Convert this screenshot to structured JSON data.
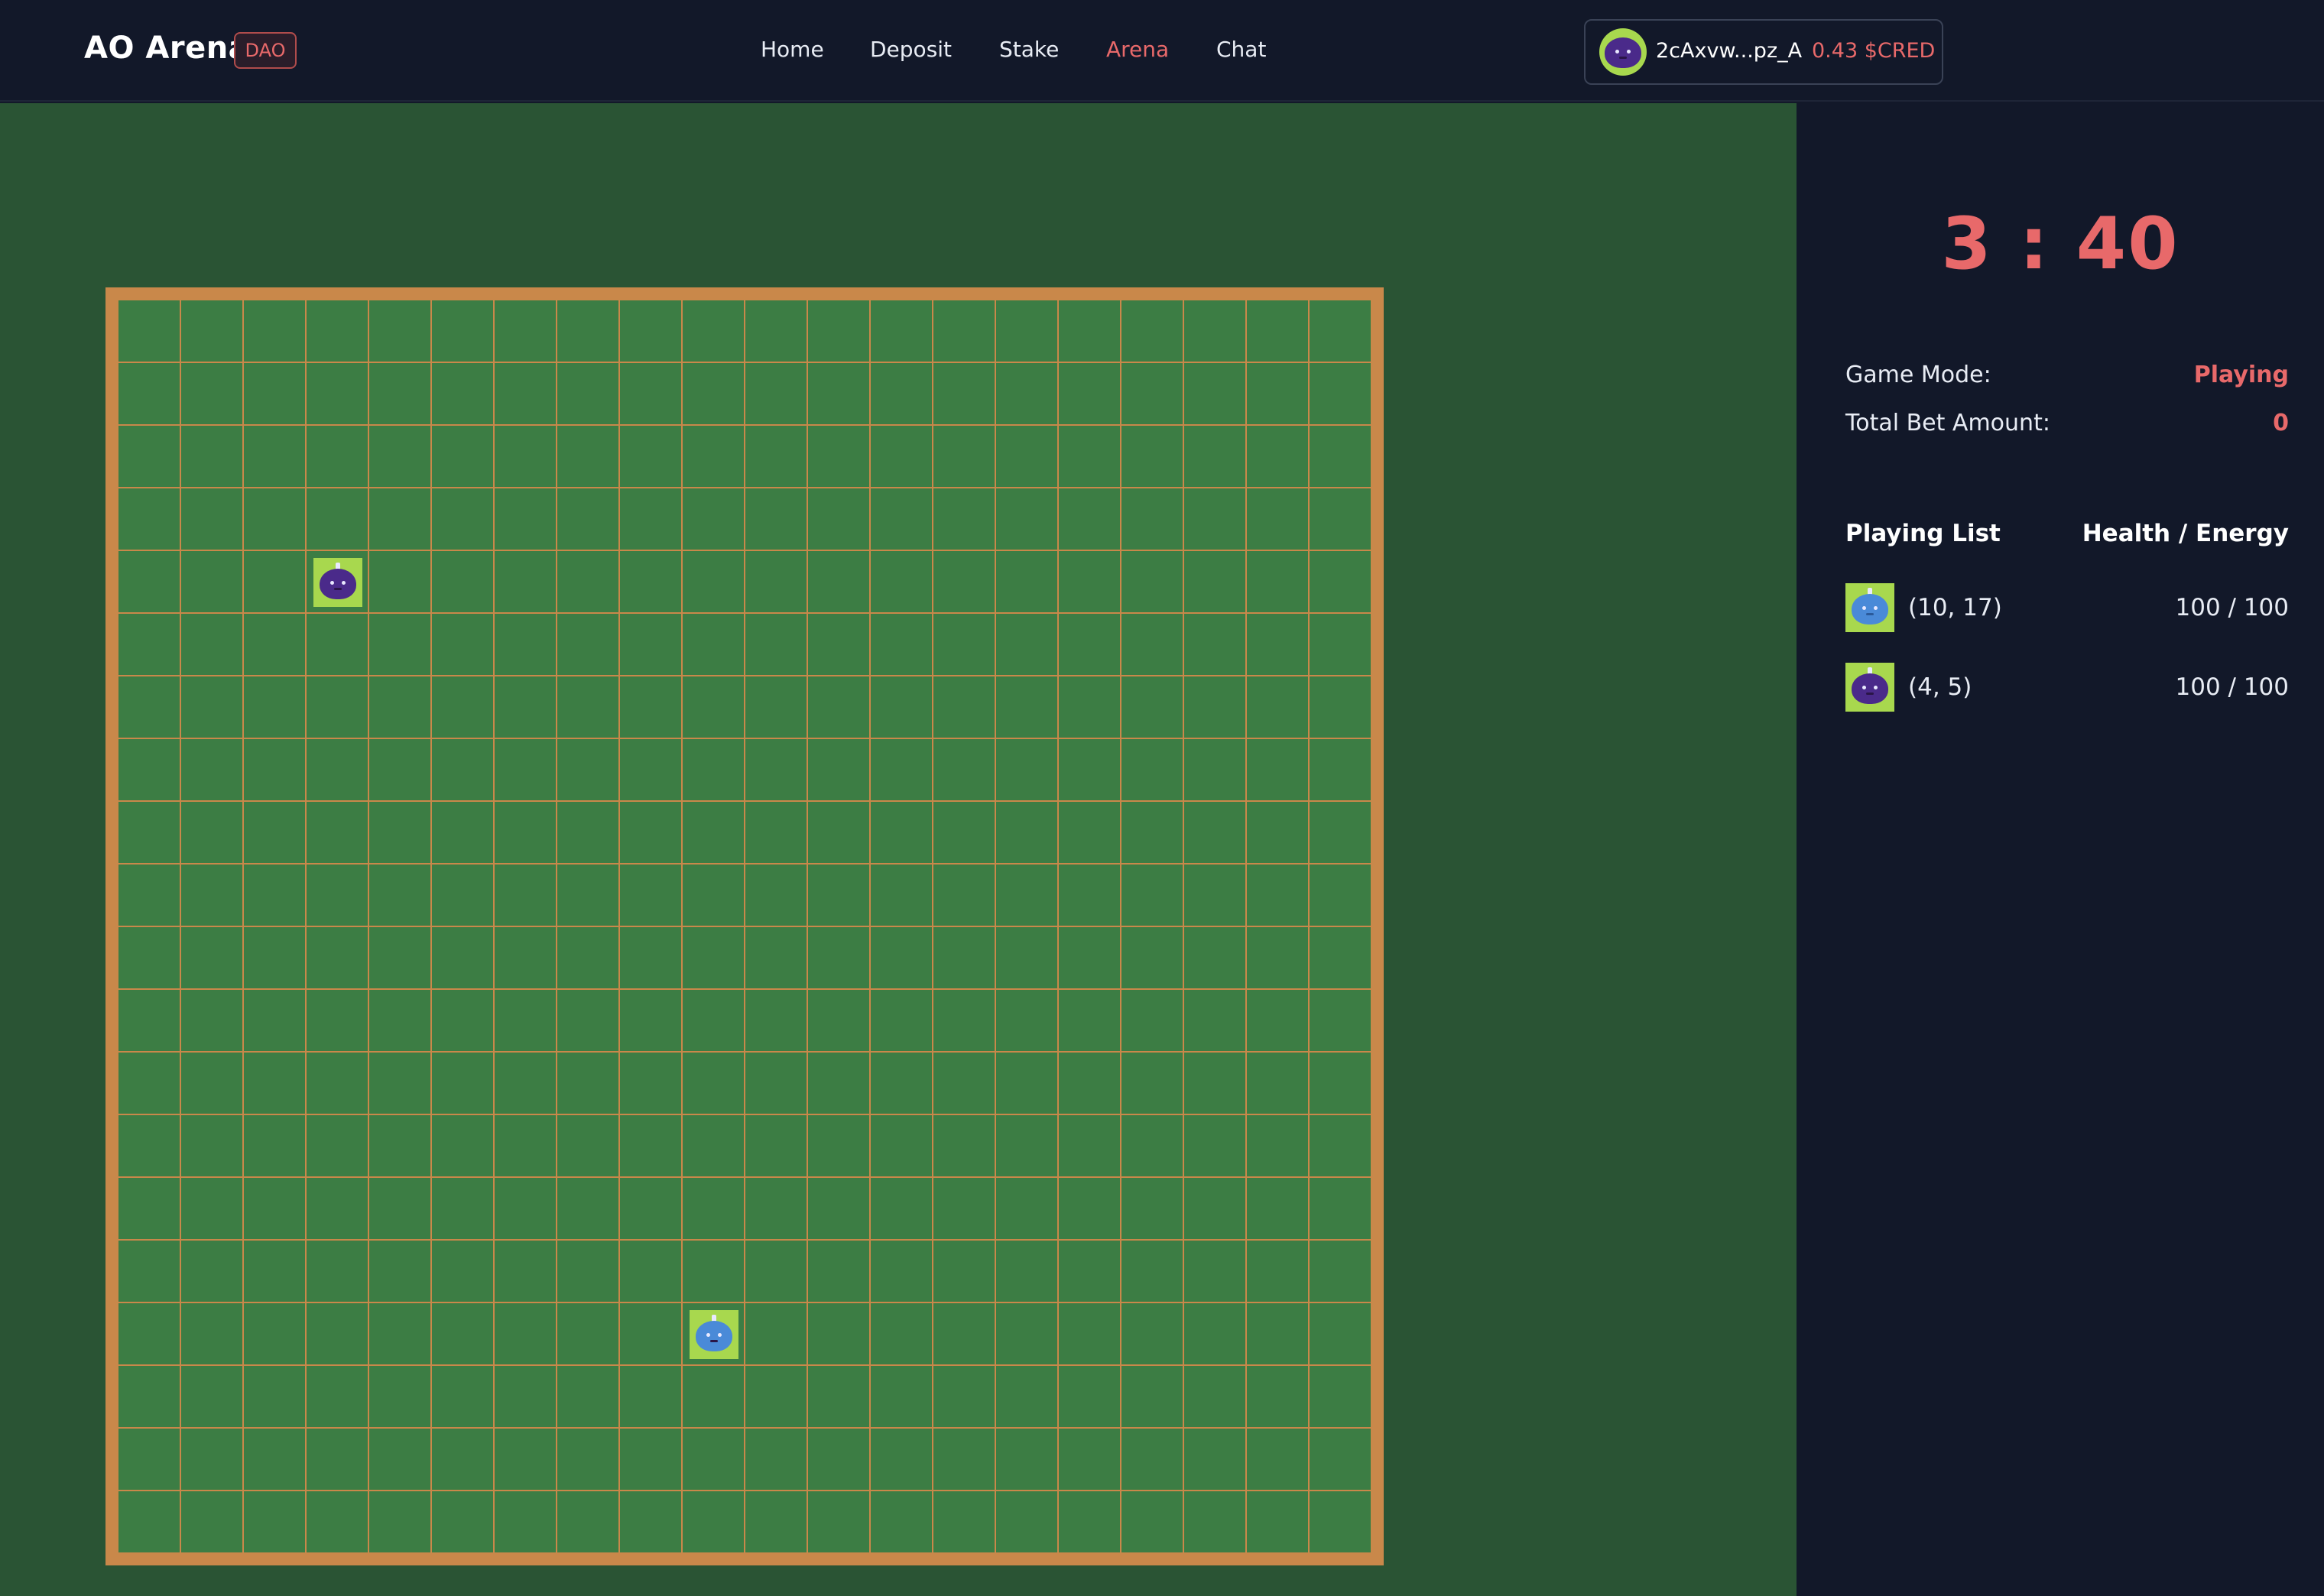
{
  "header": {
    "brand": "AO Arena",
    "badge": "DAO",
    "nav": [
      {
        "label": "Home",
        "active": false
      },
      {
        "label": "Deposit",
        "active": false
      },
      {
        "label": "Stake",
        "active": false
      },
      {
        "label": "Arena",
        "active": true
      },
      {
        "label": "Chat",
        "active": false
      }
    ],
    "wallet": {
      "address": "2cAxvw...pz_A",
      "balance": "0.43 $CRED"
    }
  },
  "board": {
    "grid_size": 20,
    "players": [
      {
        "position": [
          10,
          17
        ],
        "avatar": "blue-blob-icon",
        "color": "#4a8ad8"
      },
      {
        "position": [
          4,
          5
        ],
        "avatar": "purple-blob-icon",
        "color": "#4a2a8a"
      }
    ]
  },
  "sidebar": {
    "timer": "3 : 40",
    "game_mode_label": "Game Mode:",
    "game_mode_value": "Playing",
    "bet_label": "Total Bet Amount:",
    "bet_value": "0",
    "list_title": "Playing List",
    "stats_title": "Health / Energy",
    "players": [
      {
        "position_text": "(10, 17)",
        "stats": "100 / 100",
        "avatar": "blue-blob-icon"
      },
      {
        "position_text": "(4, 5)",
        "stats": "100 / 100",
        "avatar": "purple-blob-icon"
      }
    ]
  },
  "colors": {
    "accent": "#e8696a",
    "board_cell": "#3c7d44",
    "board_line": "#c9884a",
    "avatar_bg": "#a8d84e"
  }
}
